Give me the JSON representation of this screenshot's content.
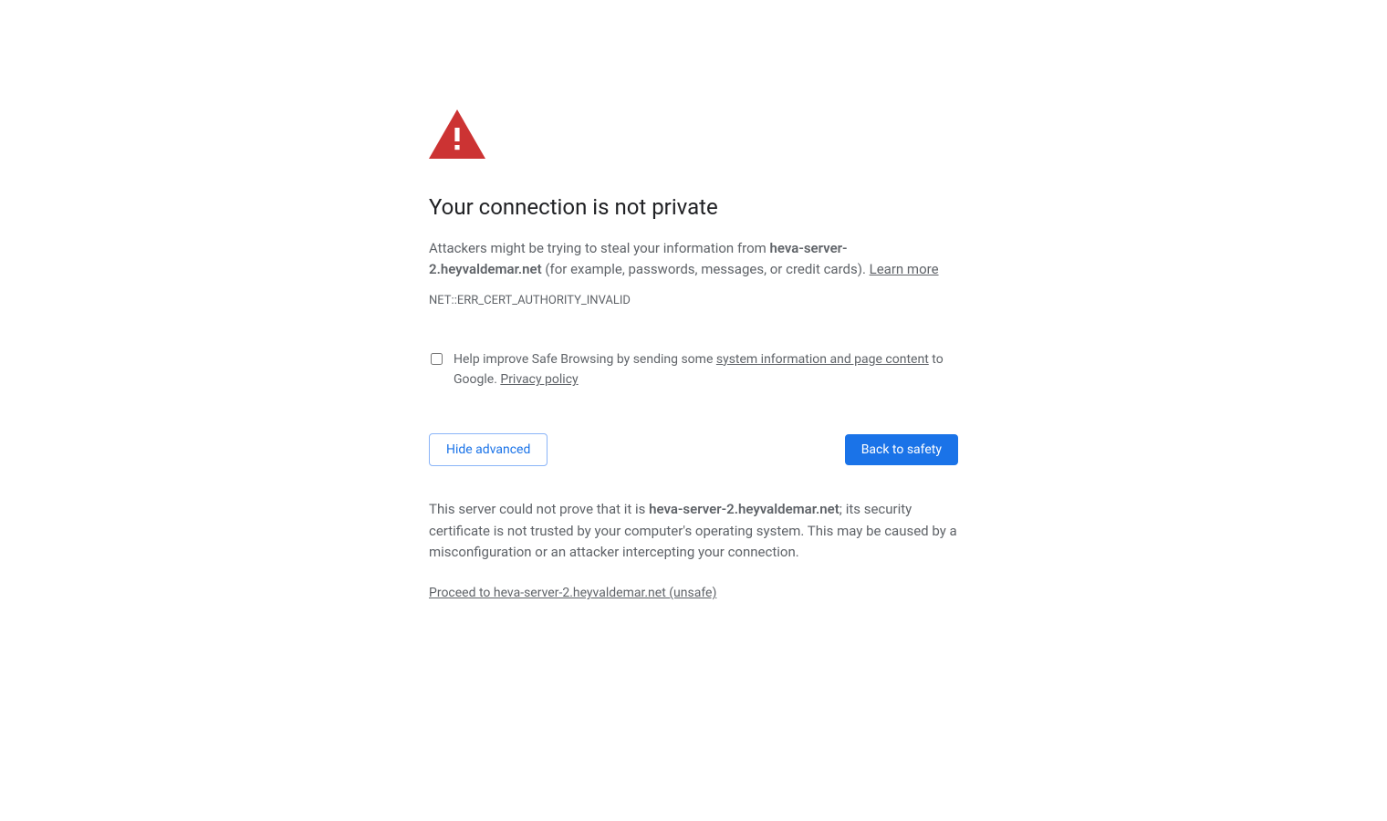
{
  "icon_color": "#cc3333",
  "title": "Your connection is not private",
  "description_prefix": "Attackers might be trying to steal your information from ",
  "description_host": "heva-server-2.heyvaldemar.net",
  "description_suffix": " (for example, passwords, messages, or credit cards). ",
  "learn_more_label": "Learn more",
  "error_code": "NET::ERR_CERT_AUTHORITY_INVALID",
  "optin": {
    "prefix": "Help improve Safe Browsing by sending some ",
    "link": "system information and page content",
    "suffix": " to Google. ",
    "privacy_label": "Privacy policy"
  },
  "buttons": {
    "advanced": "Hide advanced",
    "back_to_safety": "Back to safety"
  },
  "advanced": {
    "text_prefix": "This server could not prove that it is ",
    "host": "heva-server-2.heyvaldemar.net",
    "text_suffix": "; its security certificate is not trusted by your computer's operating system. This may be caused by a misconfiguration or an attacker intercepting your connection.",
    "proceed_label": "Proceed to heva-server-2.heyvaldemar.net (unsafe)"
  }
}
